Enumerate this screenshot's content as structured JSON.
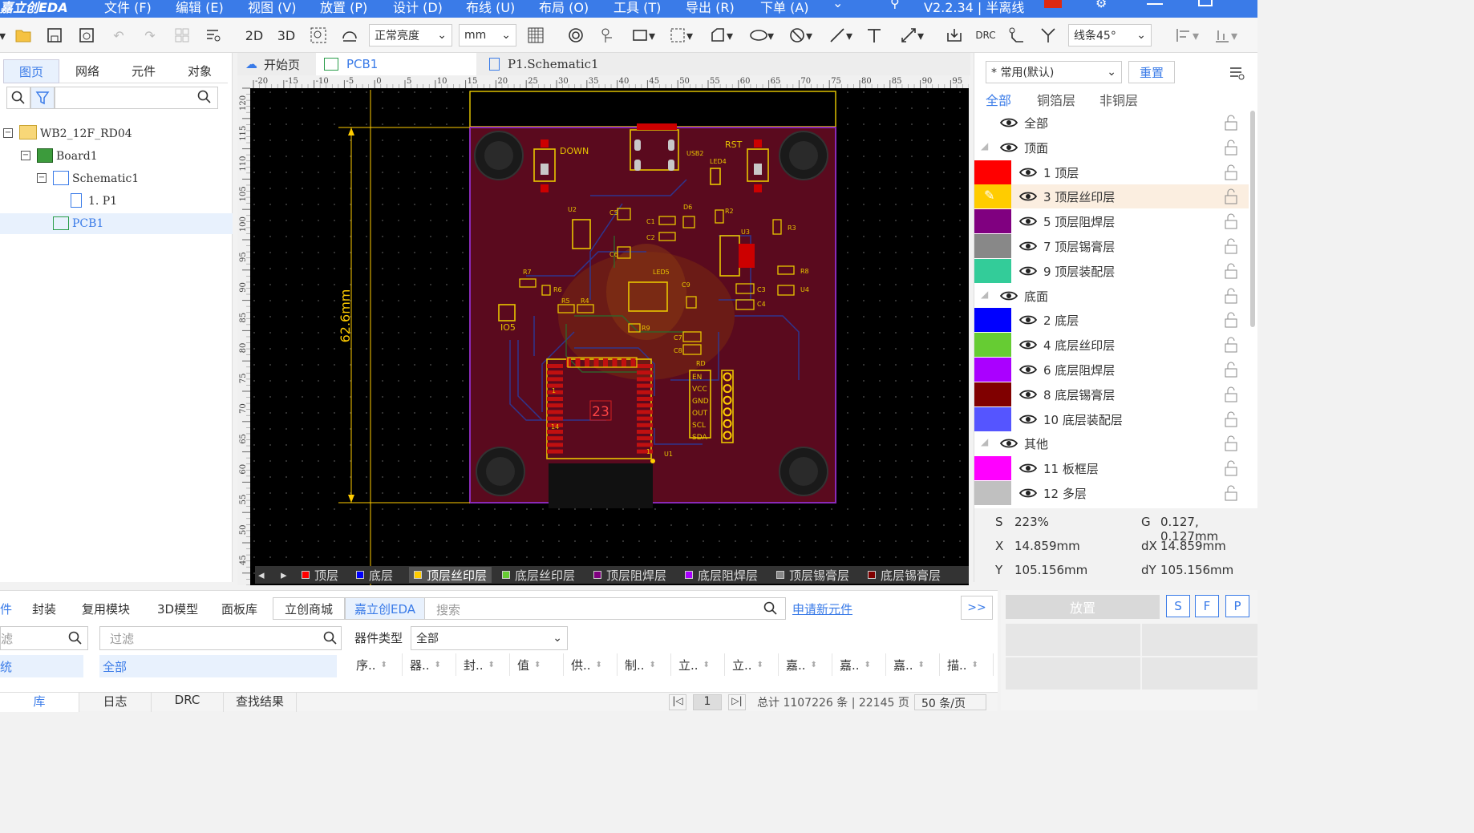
{
  "menubar": {
    "app_name": "嘉立创EDA",
    "items": [
      "文件 (F)",
      "编辑 (E)",
      "视图 (V)",
      "放置 (P)",
      "设计 (D)",
      "布线 (U)",
      "布局 (O)",
      "工具 (T)",
      "导出 (R)",
      "下单 (A)"
    ],
    "version": "V2.2.34 | 半离线"
  },
  "toolbar": {
    "view_2d": "2D",
    "view_3d": "3D",
    "brightness": "正常亮度",
    "unit": "mm",
    "drc": "DRC",
    "route_angle": "线条45°"
  },
  "left_panel": {
    "tabs": [
      "图页",
      "网络",
      "元件",
      "对象"
    ],
    "active_tab": "图页",
    "tree": [
      {
        "label": "WB2_12F_RD04",
        "icon": "folder-icon"
      },
      {
        "label": "Board1",
        "icon": "board-icon"
      },
      {
        "label": "Schematic1",
        "icon": "schematic-icon"
      },
      {
        "label": "1. P1",
        "icon": "page-icon"
      },
      {
        "label": "PCB1",
        "icon": "pcb-icon"
      }
    ]
  },
  "doc_tabs": [
    "开始页",
    "PCB1",
    "P1.Schematic1"
  ],
  "canvas": {
    "dimension_label": "62.6mm",
    "top_ruler": [
      "-20",
      "-15",
      "-10",
      "-5",
      "0",
      "5",
      "10",
      "15",
      "20",
      "25",
      "30",
      "35",
      "40",
      "45",
      "50",
      "55",
      "60",
      "65",
      "70",
      "75",
      "80",
      "85",
      "90",
      "95"
    ],
    "left_ruler": [
      "120",
      "115",
      "110",
      "105",
      "100",
      "95",
      "90",
      "85",
      "80",
      "75",
      "70",
      "65",
      "60",
      "55",
      "50",
      "45",
      "40"
    ],
    "silk_labels": {
      "down": "DOWN",
      "rst": "RST",
      "usb2": "USB2",
      "led4": "LED4",
      "d6": "D6",
      "r2": "R2",
      "r3": "R3",
      "u2": "U2",
      "u3": "U3",
      "c5": "C5",
      "c1": "C1",
      "c2": "C2",
      "c6": "C6",
      "led5": "LED5",
      "c9": "C9",
      "c3": "C3",
      "c4": "C4",
      "r8": "R8",
      "u4": "U4",
      "r7": "R7",
      "r6": "R6",
      "r5": "R5",
      "r4": "R4",
      "r9": "R9",
      "io5": "IO5",
      "c7": "C7",
      "c8": "C8",
      "rd": "RD",
      "u1": "U1",
      "num23": "23",
      "pin1": "1",
      "pin14": "14",
      "pin1b": "1"
    },
    "header_pins": [
      "EN",
      "VCC",
      "GND",
      "OUT",
      "SCL",
      "SDA"
    ]
  },
  "layer_bar": [
    {
      "label": "顶层",
      "color": "#ff0000"
    },
    {
      "label": "底层",
      "color": "#0000ff"
    },
    {
      "label": "顶层丝印层",
      "color": "#ffcc00"
    },
    {
      "label": "底层丝印层",
      "color": "#66cc33"
    },
    {
      "label": "顶层阻焊层",
      "color": "#800080"
    },
    {
      "label": "底层阻焊层",
      "color": "#aa00ff"
    },
    {
      "label": "顶层锡膏层",
      "color": "#888888"
    },
    {
      "label": "底层锡膏层",
      "color": "#800000"
    }
  ],
  "right_panel": {
    "preset": "* 常用(默认)",
    "reset": "重置",
    "filter_tabs": [
      "全部",
      "铜箔层",
      "非铜层"
    ],
    "layers": [
      {
        "label": "全部",
        "group": true
      },
      {
        "label": "顶面",
        "group": true
      },
      {
        "label": "1 顶层",
        "color": "#ff0000"
      },
      {
        "label": "3 顶层丝印层",
        "color": "#ffcc00",
        "active": true
      },
      {
        "label": "5 顶层阻焊层",
        "color": "#800080"
      },
      {
        "label": "7 顶层锡膏层",
        "color": "#888888"
      },
      {
        "label": "9 顶层装配层",
        "color": "#33cc99"
      },
      {
        "label": "底面",
        "group": true
      },
      {
        "label": "2 底层",
        "color": "#0000ff"
      },
      {
        "label": "4 底层丝印层",
        "color": "#66cc33"
      },
      {
        "label": "6 底层阻焊层",
        "color": "#aa00ff"
      },
      {
        "label": "8 底层锡膏层",
        "color": "#800000"
      },
      {
        "label": "10 底层装配层",
        "color": "#5555ff"
      },
      {
        "label": "其他",
        "group": true
      },
      {
        "label": "11 板框层",
        "color": "#ff00ff"
      },
      {
        "label": "12 多层",
        "color": "#c0c0c0"
      }
    ],
    "status": {
      "s_label": "S",
      "s_value": "223%",
      "g_label": "G",
      "g_value": "0.127, 0.127mm",
      "x_label": "X",
      "x_value": "14.859mm",
      "dx_label": "dX",
      "dx_value": "14.859mm",
      "y_label": "Y",
      "y_value": "105.156mm",
      "dy_label": "dY",
      "dy_value": "105.156mm"
    }
  },
  "bottom_panel": {
    "tabs": [
      "件",
      "封装",
      "复用模块",
      "3D模型",
      "面板库",
      "立创商城",
      "嘉立创EDA"
    ],
    "search_placeholder": "搜索",
    "apply_link": "申请新元件",
    "more": ">>",
    "filter_left_placeholder": "滤",
    "filter_placeholder": "过滤",
    "left_item": "统",
    "filter_item": "全部",
    "type_label": "器件类型",
    "type_value": "全部",
    "columns": [
      "序..",
      "器..",
      "封..",
      "值",
      "供..",
      "制..",
      "立..",
      "立..",
      "嘉..",
      "嘉..",
      "嘉..",
      "描.."
    ],
    "footer_tabs": [
      "库",
      "日志",
      "DRC",
      "查找结果"
    ],
    "page_number": "1",
    "total": "总计 1107226 条 | 22145 页",
    "per_page": "50 条/页"
  },
  "place_panel": {
    "place_button": "放置",
    "s": "S",
    "f": "F",
    "p": "P"
  }
}
